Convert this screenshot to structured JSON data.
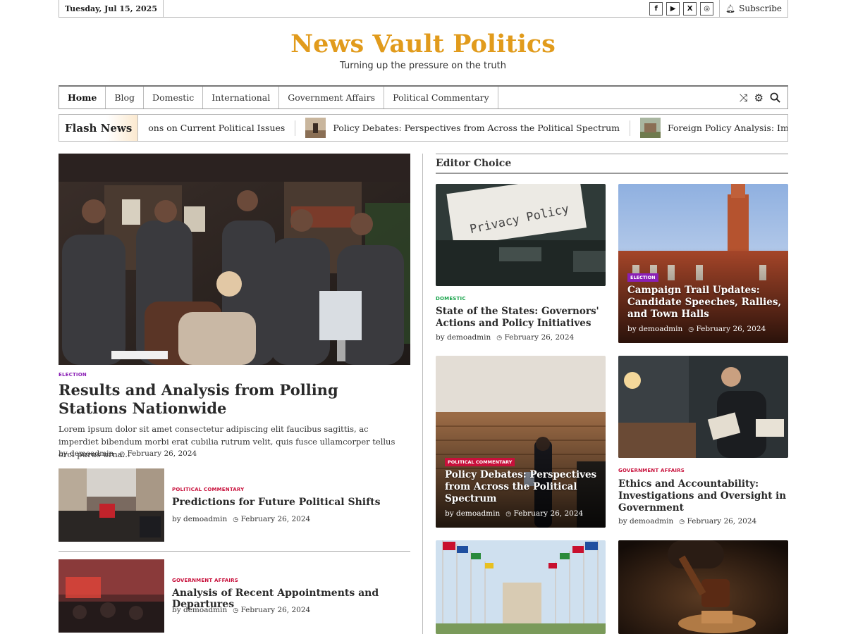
{
  "topbar": {
    "date": "Tuesday, Jul 15, 2025",
    "social": [
      {
        "icon": "facebook-icon",
        "glyph": "f"
      },
      {
        "icon": "youtube-icon",
        "glyph": "▶"
      },
      {
        "icon": "x-icon",
        "glyph": "X"
      },
      {
        "icon": "instagram-icon",
        "glyph": "◎"
      }
    ],
    "subscribe": "Subscribe"
  },
  "header": {
    "title": "News Vault Politics",
    "tagline": "Turning up the pressure on the truth",
    "title_color": "#e19b1c"
  },
  "nav": {
    "items": [
      "Home",
      "Blog",
      "Domestic",
      "International",
      "Government Affairs",
      "Political Commentary"
    ]
  },
  "flash": {
    "label_a": "Flash",
    "label_b": "News",
    "items": [
      "ons on Current Political Issues",
      "Policy Debates: Perspectives from Across the Political Spectrum",
      "Foreign Policy Analysis: Implications of U.S. Actions on"
    ]
  },
  "hero": {
    "category": "Election",
    "title": "Results and Analysis from Polling Stations Nationwide",
    "excerpt": "Lorem ipsum dolor sit amet consectetur adipiscing elit faucibus sagittis, ac imperdiet bibendum morbi erat cubilia rutrum velit, quis fusce ullamcorper tellus orci purus urna...",
    "author": "by demoadmin",
    "date": "February 26, 2024"
  },
  "list": [
    {
      "category": "Political Commentary",
      "title": "Predictions for Future Political Shifts",
      "author": "by demoadmin",
      "date": "February 26, 2024"
    },
    {
      "category": "Government Affairs",
      "title": "Analysis of Recent Appointments and Departures",
      "author": "by demoadmin",
      "date": "February 26, 2024"
    }
  ],
  "editor_choice": {
    "heading": "Editor Choice",
    "cards": [
      {
        "category": "Domestic",
        "title": "State of the States: Governors' Actions and Policy Initiatives",
        "author": "by demoadmin",
        "date": "February 26, 2024",
        "image_text": "Privacy Policy"
      },
      {
        "category": "Election",
        "title": "Campaign Trail Updates: Candidate Speeches, Rallies, and Town Halls",
        "author": "by demoadmin",
        "date": "February 26, 2024"
      },
      {
        "category": "Political Commentary",
        "title": "Policy Debates: Perspectives from Across the Political Spectrum",
        "author": "by demoadmin",
        "date": "February 26, 2024"
      },
      {
        "category": "Government Affairs",
        "title": "Ethics and Accountability: Investigations and Oversight in Government",
        "author": "by demoadmin",
        "date": "February 26, 2024"
      }
    ]
  },
  "colors": {
    "purple": "#8a1fb5",
    "green": "#17a34a",
    "red": "#c8103b"
  }
}
